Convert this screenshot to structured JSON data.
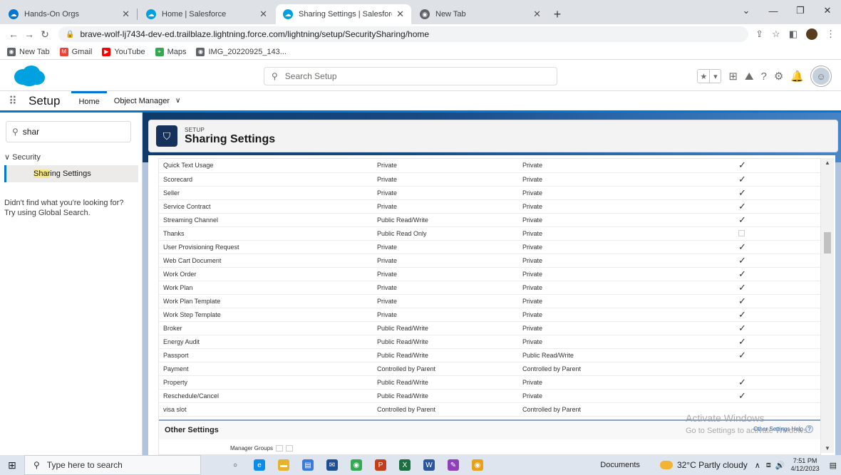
{
  "browser": {
    "tabs": [
      {
        "title": "Hands-On Orgs",
        "color": "#0176d3"
      },
      {
        "title": "Home | Salesforce",
        "color": "#00a1e0"
      },
      {
        "title": "Sharing Settings | Salesforce",
        "color": "#00a1e0"
      },
      {
        "title": "New Tab",
        "color": "#5f6368"
      }
    ],
    "url": "brave-wolf-lj7434-dev-ed.trailblaze.lightning.force.com/lightning/setup/SecuritySharing/home",
    "bookmarks": [
      {
        "label": "New Tab",
        "color": "#5f6368"
      },
      {
        "label": "Gmail",
        "color": "#ea4335"
      },
      {
        "label": "YouTube",
        "color": "#ff0000"
      },
      {
        "label": "Maps",
        "color": "#34a853"
      },
      {
        "label": "IMG_20220925_143...",
        "color": "#5f6368"
      }
    ]
  },
  "sf": {
    "search_placeholder": "Search Setup",
    "nav": {
      "app_name": "Setup",
      "home_tab": "Home",
      "object_manager_tab": "Object Manager"
    },
    "sidebar": {
      "quick_find_value": "shar",
      "section": "Security",
      "item_prefix": "",
      "item_highlight": "Shar",
      "item_suffix": "ing Settings",
      "not_found_line1": "Didn't find what you're looking for?",
      "not_found_line2": "Try using Global Search."
    },
    "page": {
      "eyebrow": "SETUP",
      "title": "Sharing Settings"
    },
    "table": {
      "rows": [
        {
          "object": "Quick Text Usage",
          "default_internal": "Private",
          "default_external": "Private",
          "grant_access": true
        },
        {
          "object": "Scorecard",
          "default_internal": "Private",
          "default_external": "Private",
          "grant_access": true
        },
        {
          "object": "Seller",
          "default_internal": "Private",
          "default_external": "Private",
          "grant_access": true
        },
        {
          "object": "Service Contract",
          "default_internal": "Private",
          "default_external": "Private",
          "grant_access": true
        },
        {
          "object": "Streaming Channel",
          "default_internal": "Public Read/Write",
          "default_external": "Private",
          "grant_access": true
        },
        {
          "object": "Thanks",
          "default_internal": "Public Read Only",
          "default_external": "Private",
          "grant_access": false
        },
        {
          "object": "User Provisioning Request",
          "default_internal": "Private",
          "default_external": "Private",
          "grant_access": true
        },
        {
          "object": "Web Cart Document",
          "default_internal": "Private",
          "default_external": "Private",
          "grant_access": true
        },
        {
          "object": "Work Order",
          "default_internal": "Private",
          "default_external": "Private",
          "grant_access": true
        },
        {
          "object": "Work Plan",
          "default_internal": "Private",
          "default_external": "Private",
          "grant_access": true
        },
        {
          "object": "Work Plan Template",
          "default_internal": "Private",
          "default_external": "Private",
          "grant_access": true
        },
        {
          "object": "Work Step Template",
          "default_internal": "Private",
          "default_external": "Private",
          "grant_access": true
        },
        {
          "object": "Broker",
          "default_internal": "Public Read/Write",
          "default_external": "Private",
          "grant_access": true
        },
        {
          "object": "Energy Audit",
          "default_internal": "Public Read/Write",
          "default_external": "Private",
          "grant_access": true
        },
        {
          "object": "Passport",
          "default_internal": "Public Read/Write",
          "default_external": "Public Read/Write",
          "grant_access": true
        },
        {
          "object": "Payment",
          "default_internal": "Controlled by Parent",
          "default_external": "Controlled by Parent",
          "grant_access": null
        },
        {
          "object": "Property",
          "default_internal": "Public Read/Write",
          "default_external": "Private",
          "grant_access": true
        },
        {
          "object": "Reschedule/Cancel",
          "default_internal": "Public Read/Write",
          "default_external": "Private",
          "grant_access": true
        },
        {
          "object": "visa slot",
          "default_internal": "Controlled by Parent",
          "default_external": "Controlled by Parent",
          "grant_access": null
        }
      ]
    },
    "other_settings": {
      "title": "Other Settings",
      "help_link": "Other Settings Help",
      "manager_groups_label": "Manager Groups"
    }
  },
  "watermark": {
    "line1": "Activate Windows",
    "line2": "Go to Settings to activate Windows."
  },
  "taskbar": {
    "search_placeholder": "Type here to search",
    "docs_label": "Documents",
    "weather": "32°C  Partly cloudy",
    "time": "7:51 PM",
    "date": "4/12/2023"
  }
}
